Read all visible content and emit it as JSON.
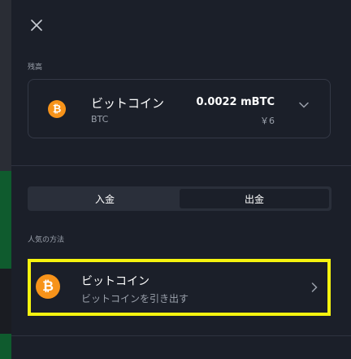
{
  "balance_section": {
    "label": "残高",
    "currency_name": "ビットコイン",
    "currency_code": "BTC",
    "amount": "0.0022 mBTC",
    "fiat_value": "￥6"
  },
  "tabs": [
    {
      "label": "入金",
      "active": false
    },
    {
      "label": "出金",
      "active": true
    }
  ],
  "popular_methods": {
    "label": "人気の方法",
    "items": [
      {
        "title": "ビットコイン",
        "subtitle": "ビットコインを引き出す",
        "icon": "bitcoin-icon"
      }
    ]
  },
  "colors": {
    "panel_bg": "#1b1f29",
    "bitcoin_orange": "#f7931a",
    "highlight_yellow": "#f5f30f"
  }
}
